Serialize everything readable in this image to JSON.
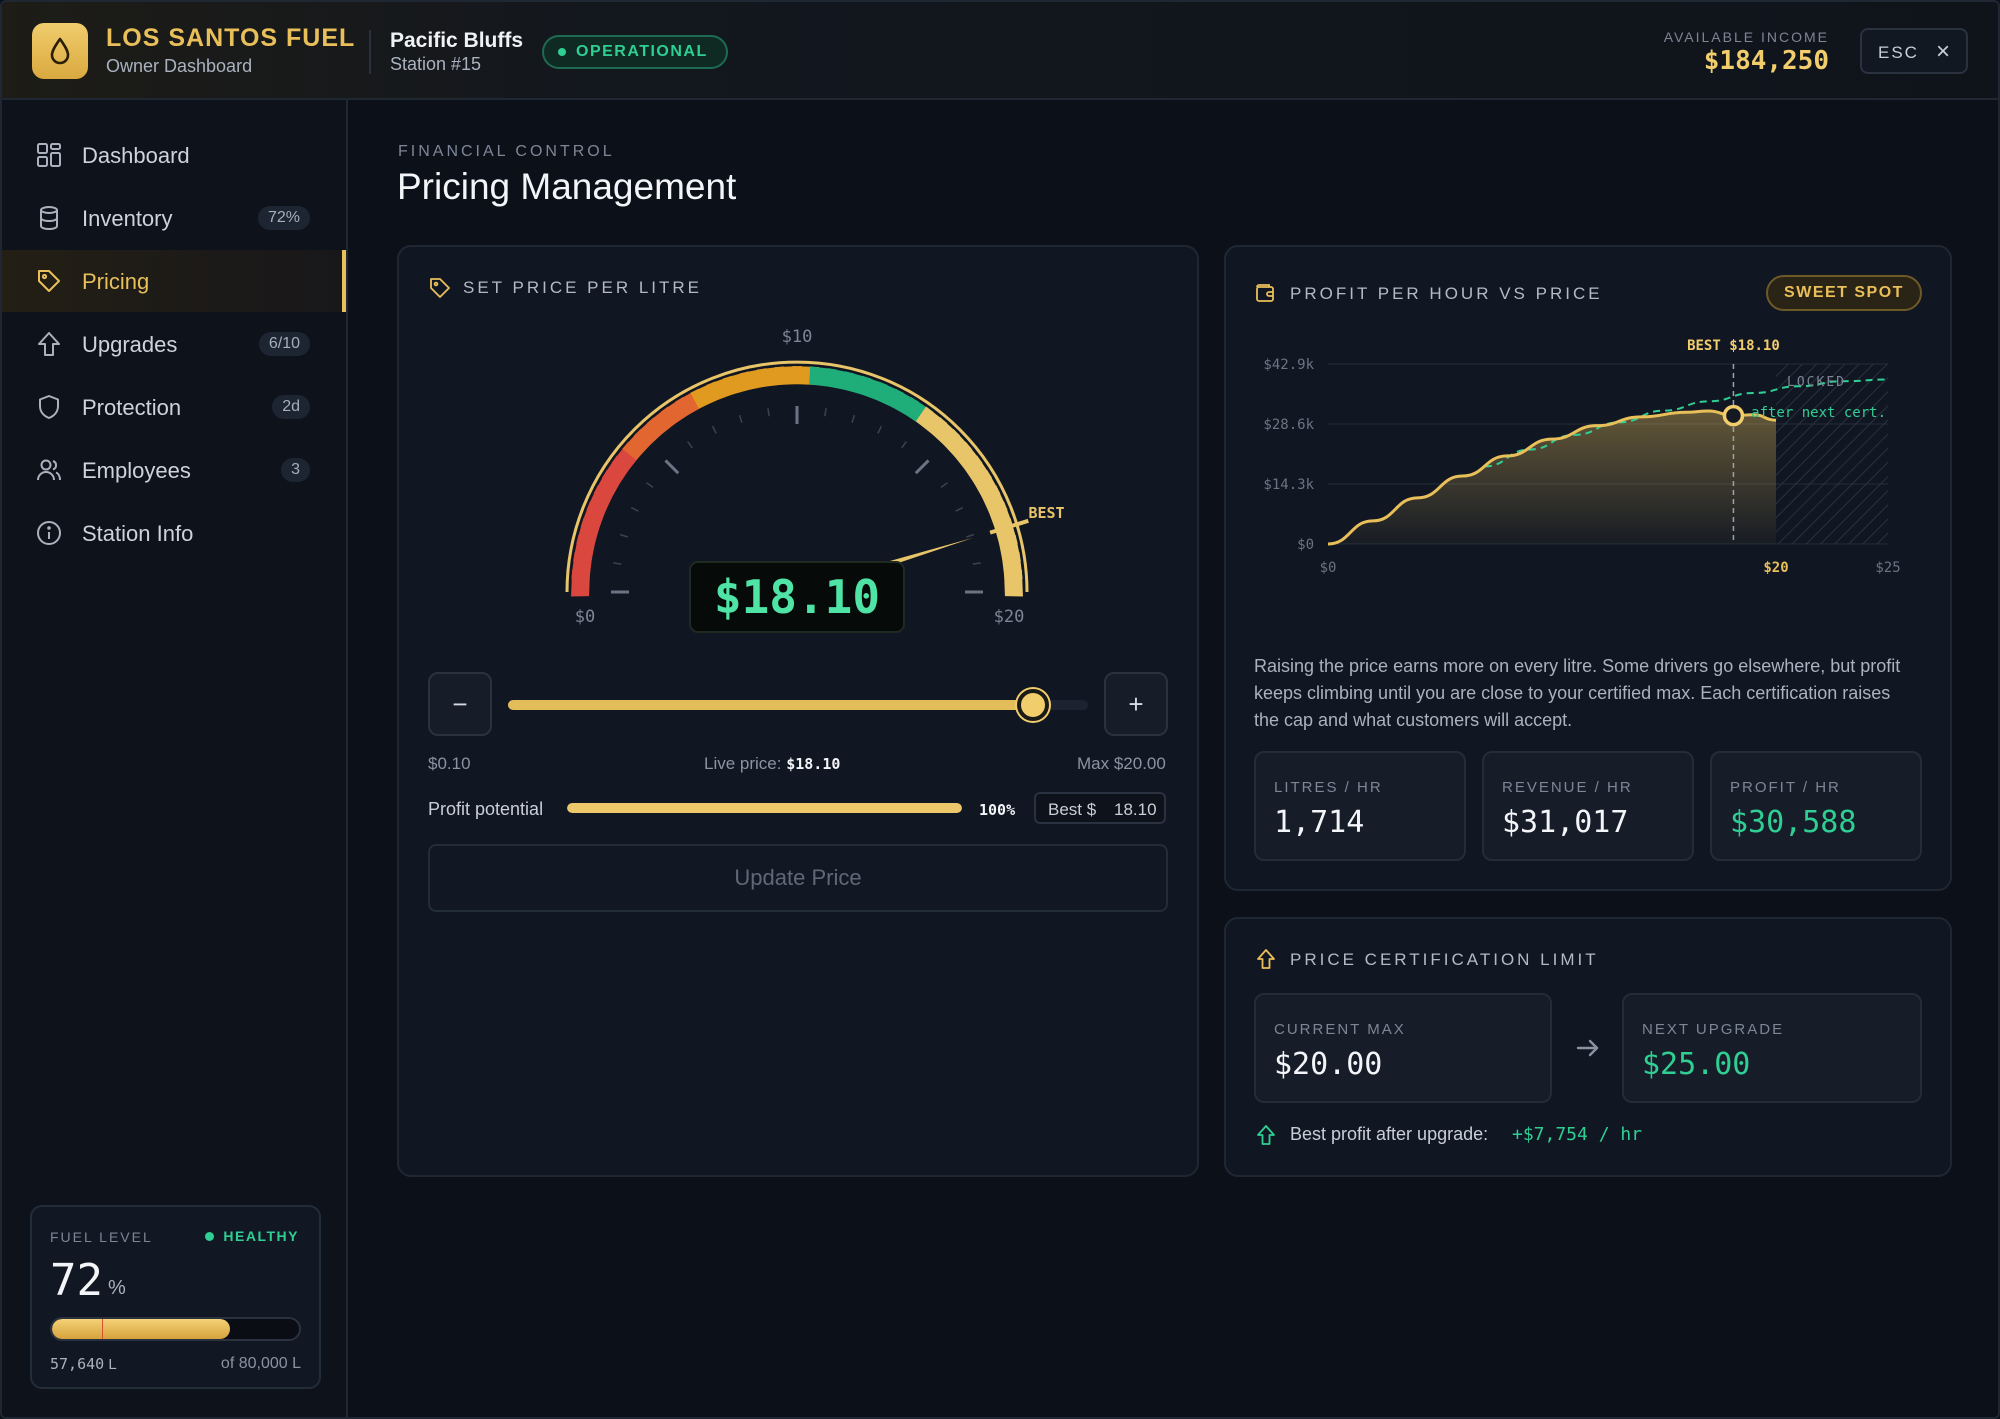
{
  "header": {
    "brand": "LOS SANTOS FUEL",
    "brand_sub": "Owner Dashboard",
    "station_name": "Pacific Bluffs",
    "station_id": "Station #15",
    "status": "OPERATIONAL",
    "income_label": "AVAILABLE INCOME",
    "income_value": "$184,250",
    "esc_label": "ESC"
  },
  "sidebar": {
    "items": [
      {
        "label": "Dashboard",
        "icon": "grid-icon",
        "count": ""
      },
      {
        "label": "Inventory",
        "icon": "database-icon",
        "count": "72%"
      },
      {
        "label": "Pricing",
        "icon": "tag-icon",
        "count": ""
      },
      {
        "label": "Upgrades",
        "icon": "arrow-up-icon",
        "count": "6/10"
      },
      {
        "label": "Protection",
        "icon": "shield-icon",
        "count": "2d"
      },
      {
        "label": "Employees",
        "icon": "users-icon",
        "count": "3"
      },
      {
        "label": "Station Info",
        "icon": "info-icon",
        "count": ""
      }
    ],
    "active_index": 2,
    "fuel": {
      "label": "FUEL LEVEL",
      "status": "HEALTHY",
      "percent": "72",
      "unit": "%",
      "litres": "57,640",
      "litres_unit": "L",
      "capacity": "of 80,000 L",
      "level": 0.72
    }
  },
  "main": {
    "eyebrow": "FINANCIAL CONTROL",
    "title": "Pricing Management"
  },
  "price_card": {
    "title": "SET PRICE PER LITRE",
    "gauge": {
      "min_label": "$0",
      "mid_label": "$10",
      "max_label": "$20",
      "best_label": "BEST",
      "readout": "$18.10",
      "value": 18.1,
      "max": 20
    },
    "minus_label": "−",
    "plus_label": "+",
    "slider_min": "$0.10",
    "live_price_label": "Live price:",
    "live_price_value": "$18.10",
    "slider_max": "Max $20.00",
    "slider_value": 18.1,
    "slider_range": [
      0.1,
      20
    ],
    "profit_label": "Profit potential",
    "profit_pct": "100%",
    "profit_fraction": 1.0,
    "best_prefix": "Best $",
    "best_value": "18.10",
    "update_label": "Update Price"
  },
  "profit_card": {
    "title": "PROFIT PER HOUR VS PRICE",
    "badge": "SWEET SPOT",
    "description": "Raising the price earns more on every litre. Some drivers go elsewhere, but profit keeps climbing until you are close to your certified max. Each certification raises the cap and what customers will accept.",
    "stats": [
      {
        "label": "LITRES / HR",
        "value": "1,714",
        "color": "#f3f5f8"
      },
      {
        "label": "REVENUE / HR",
        "value": "$31,017",
        "color": "#f3f5f8"
      },
      {
        "label": "PROFIT / HR",
        "value": "$30,588",
        "color": "#2fcf93"
      }
    ]
  },
  "chart_data": {
    "type": "area",
    "x_tick_labels": [
      "$0",
      "$20",
      "$25"
    ],
    "y_tick_labels": [
      "$42.9k",
      "$28.6k",
      "$14.3k",
      "$0"
    ],
    "xlim": [
      0,
      25
    ],
    "ylim": [
      0,
      42.9
    ],
    "marker_label": "BEST $18.10",
    "locked_label": "LOCKED",
    "locked_sub": "after next cert.",
    "series": [
      {
        "x": [
          0,
          2,
          4,
          6,
          8,
          10,
          12,
          14,
          16,
          17,
          18.1,
          19,
          20
        ],
        "y": [
          0,
          5.5,
          11,
          16.2,
          21,
          25,
          28.2,
          30.3,
          31.4,
          31.7,
          30.6,
          30.8,
          29.5
        ]
      },
      {
        "x": [
          7,
          9,
          11,
          13,
          15,
          17,
          19,
          21,
          23,
          25
        ],
        "y": [
          18.5,
          22.5,
          26,
          29,
          31.8,
          34,
          36,
          37.6,
          38.8,
          39.2
        ]
      }
    ],
    "best_x": 18.1,
    "best_y": 30.6,
    "locked_range": [
      20,
      25
    ]
  },
  "cert_card": {
    "title": "PRICE CERTIFICATION LIMIT",
    "current_label": "CURRENT MAX",
    "current_value": "$20.00",
    "next_label": "NEXT UPGRADE",
    "next_value": "$25.00",
    "footer_label": "Best profit after upgrade:",
    "footer_value": "+$7,754 / hr"
  },
  "colors": {
    "accent": "#e9bf5a",
    "positive": "#2fcf93",
    "danger": "#d9473f",
    "background": "#0c1119"
  }
}
